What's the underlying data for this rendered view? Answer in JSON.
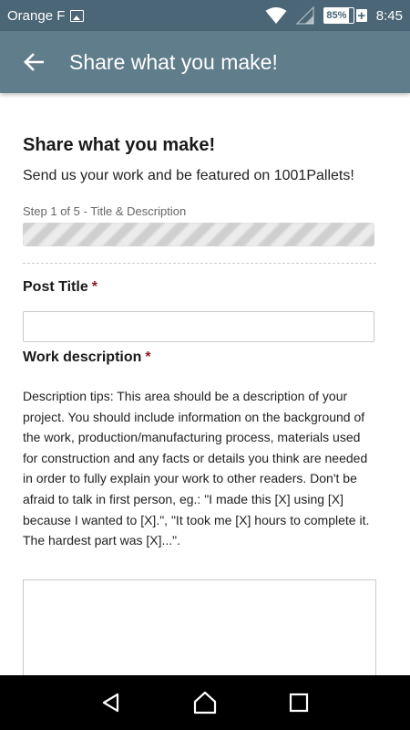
{
  "status_bar": {
    "carrier": "Orange F",
    "battery_percent": "85%",
    "battery_charging": "+",
    "time": "8:45",
    "icons": [
      "image-icon",
      "wifi-icon",
      "signal-icon",
      "battery-icon"
    ]
  },
  "app_bar": {
    "back_icon": "arrow-left-icon",
    "title": "Share what you make!"
  },
  "form": {
    "heading": "Share what you make!",
    "subheading": "Send us your work and be featured on 1001Pallets!",
    "step_label": "Step 1 of 5 - Title & Description",
    "progress_fraction": 1.0,
    "post_title_label": "Post Title",
    "post_title_value": "",
    "required_marker": "*",
    "work_description_label": "Work description",
    "description_tips": "Description tips: This area should be a description of your project. You should include information on the background of the work, production/manufacturing process, materials used for construction and any facts or details you think are needed in order to fully explain your work to other readers. Don't be afraid to talk in first person, eg.: \"I made this [X] using [X] because I wanted to [X].\", \"It took me [X] hours to complete it. The hardest part was [X]...\".",
    "description_value": ""
  },
  "nav_bar": {
    "buttons": [
      "back-triangle-icon",
      "home-icon",
      "recents-icon"
    ]
  },
  "colors": {
    "status_bar": "#4b6676",
    "app_bar": "#607d8b",
    "required": "#8b1a1a"
  }
}
